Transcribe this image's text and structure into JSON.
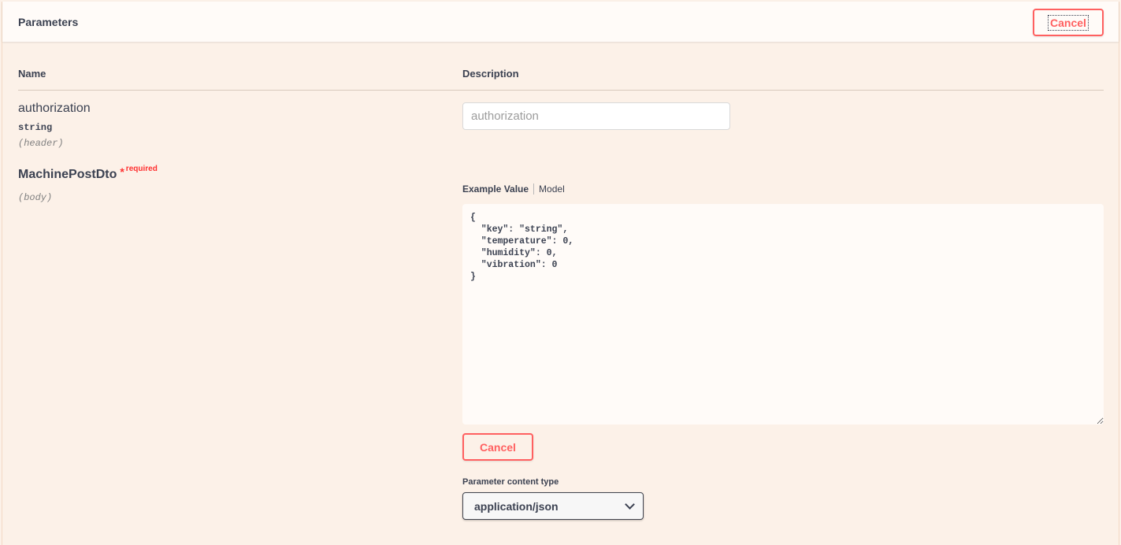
{
  "section": {
    "title": "Parameters",
    "cancel_label": "Cancel"
  },
  "columns": {
    "name": "Name",
    "description": "Description"
  },
  "params": [
    {
      "name": "authorization",
      "type": "string",
      "in": "(header)",
      "placeholder": "authorization"
    },
    {
      "name": "MachinePostDto",
      "required_star": "*",
      "required_text": "required",
      "in": "(body)"
    }
  ],
  "body": {
    "tab_example": "Example Value",
    "tab_model": "Model",
    "value": "{\n  \"key\": \"string\",\n  \"temperature\": 0,\n  \"humidity\": 0,\n  \"vibration\": 0\n}",
    "cancel_label": "Cancel"
  },
  "content_type": {
    "label": "Parameter content type",
    "selected": "application/json"
  },
  "colors": {
    "cancel": "#ff6060",
    "required": "#ff3030",
    "background": "#fcf1e8"
  }
}
